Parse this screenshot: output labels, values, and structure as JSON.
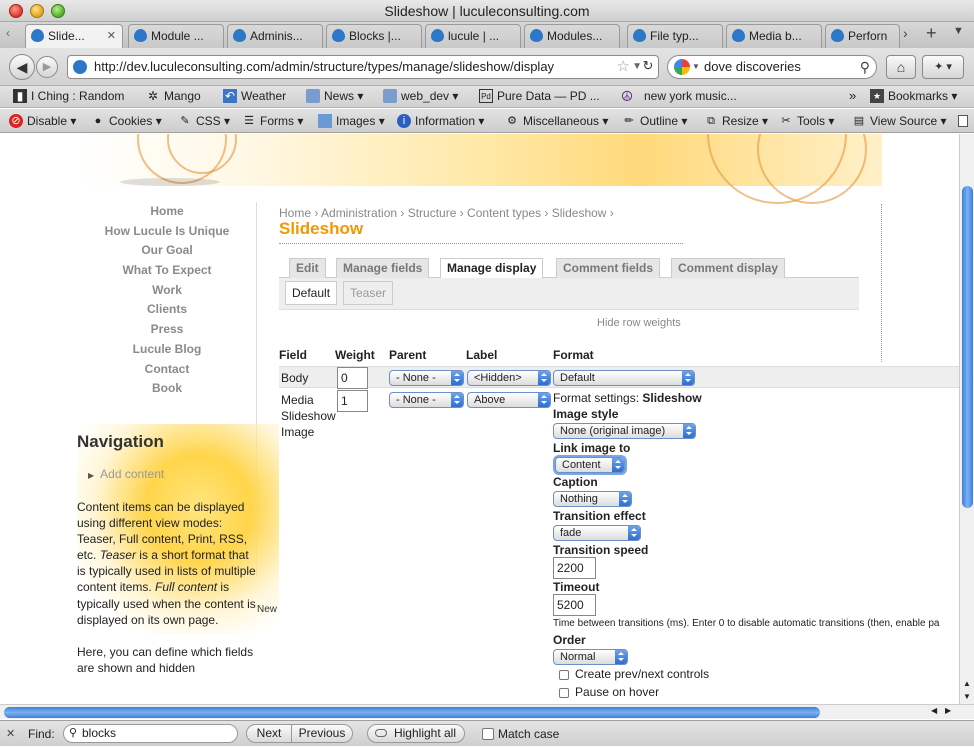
{
  "window": {
    "title": "Slideshow | luculeconsulting.com"
  },
  "tabs": [
    {
      "label": "Slide..."
    },
    {
      "label": "Module ..."
    },
    {
      "label": "Adminis..."
    },
    {
      "label": "Blocks |..."
    },
    {
      "label": "lucule | ..."
    },
    {
      "label": "Modules..."
    },
    {
      "label": "File typ..."
    },
    {
      "label": "Media b..."
    },
    {
      "label": "Perforn"
    }
  ],
  "toolbar": {
    "url": "http://dev.luculeconsulting.com/admin/structure/types/manage/slideshow/display",
    "search_value": "dove discoveries"
  },
  "bookmarks": [
    {
      "label": "I Ching : Random",
      "icon": "bookmark-icon"
    },
    {
      "label": "Mango",
      "icon": "mango-icon"
    },
    {
      "label": "Weather",
      "icon": "weather-icon"
    },
    {
      "label": "News",
      "icon": "folder-icon"
    },
    {
      "label": "web_dev",
      "icon": "folder-icon"
    },
    {
      "label": "Pure Data — PD ...",
      "icon": "pd-icon"
    },
    {
      "label": "new york music...",
      "icon": "peace-icon"
    },
    {
      "label": "Bookmarks",
      "icon": "bookmarks-icon"
    }
  ],
  "webdev": [
    "Disable",
    "Cookies",
    "CSS",
    "Forms",
    "Images",
    "Information",
    "Miscellaneous",
    "Outline",
    "Resize",
    "Tools",
    "View Source"
  ],
  "sidebar": {
    "links": [
      "Home",
      "How Lucule Is Unique",
      "Our Goal",
      "What To Expect",
      "Work",
      "Clients",
      "Press",
      "Lucule Blog",
      "Contact",
      "Book"
    ],
    "nav_heading": "Navigation",
    "add_content": "Add content",
    "help_p1_a": "Content items can be displayed using different view modes: Teaser, Full content, Print, RSS, etc. ",
    "help_p1_em1": "Teaser",
    "help_p1_b": " is a short format that is typically used in lists of multiple content items. ",
    "help_p1_em2": "Full content",
    "help_p1_c": " is typically used when the content is displayed on its own page.",
    "help_p2": "Here, you can define which fields are shown and hidden",
    "overflow_text": "New"
  },
  "page": {
    "breadcrumb": "Home › Administration › Structure › Content types › Slideshow ›",
    "title": "Slideshow",
    "tabs": [
      "Edit",
      "Manage fields",
      "Manage display",
      "Comment fields",
      "Comment display"
    ],
    "subtabs": [
      "Default",
      "Teaser"
    ],
    "hide_row_weights": "Hide row weights"
  },
  "table": {
    "headers": [
      "Field",
      "Weight",
      "Parent",
      "Label",
      "Format"
    ],
    "rows": [
      {
        "field": "Body",
        "weight": "0",
        "parent": "- None -",
        "label": "<Hidden>",
        "format": "Default"
      },
      {
        "field_l1": "Media",
        "field_l2": "Slideshow",
        "field_l3": "Image",
        "weight": "1",
        "parent": "- None -",
        "label": "Above"
      }
    ]
  },
  "format_settings": {
    "heading_prefix": "Format settings: ",
    "heading_name": "Slideshow",
    "image_style_label": "Image style",
    "image_style_value": "None (original image)",
    "link_image_label": "Link image to",
    "link_image_value": "Content",
    "caption_label": "Caption",
    "caption_value": "Nothing",
    "transition_effect_label": "Transition effect",
    "transition_effect_value": "fade",
    "transition_speed_label": "Transition speed",
    "transition_speed_value": "2200",
    "timeout_label": "Timeout",
    "timeout_value": "5200",
    "timeout_help": "Time between transitions (ms). Enter 0 to disable automatic transitions (then, enable pa",
    "order_label": "Order",
    "order_value": "Normal",
    "prevnext_label": "Create prev/next controls",
    "pause_label": "Pause on hover"
  },
  "findbar": {
    "label": "Find:",
    "value": "blocks",
    "next": "Next",
    "previous": "Previous",
    "highlight": "Highlight all",
    "match_case": "Match case"
  }
}
